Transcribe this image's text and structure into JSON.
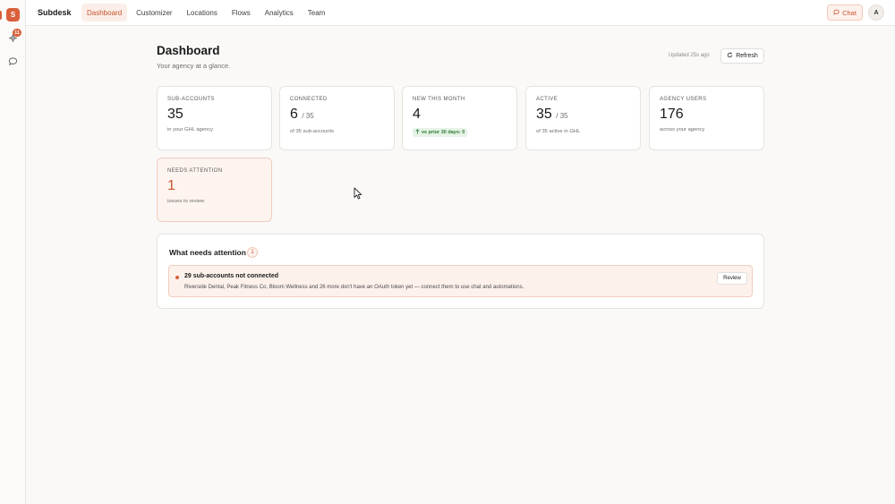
{
  "rail": {
    "logo_letter": "S",
    "notifications_badge": "11"
  },
  "topbar": {
    "brand": "Subdesk",
    "nav": [
      "Dashboard",
      "Customizer",
      "Locations",
      "Flows",
      "Analytics",
      "Team"
    ],
    "active_nav": "Dashboard",
    "chat_label": "Chat",
    "avatar_initial": "A"
  },
  "header": {
    "title": "Dashboard",
    "subtitle": "Your agency at a glance.",
    "updated": "Updated 25s ago",
    "refresh_label": "Refresh"
  },
  "stats": [
    {
      "label": "SUB-ACCOUNTS",
      "value": "35",
      "of": "",
      "note": "in your GHL agency"
    },
    {
      "label": "CONNECTED",
      "value": "6",
      "of": "/ 35",
      "note": "of 35 sub-accounts"
    },
    {
      "label": "NEW THIS MONTH",
      "value": "4",
      "of": "",
      "trend": "vs prior 30 days: 0"
    },
    {
      "label": "ACTIVE",
      "value": "35",
      "of": "/ 35",
      "note": "of 35 active in GHL"
    },
    {
      "label": "AGENCY USERS",
      "value": "176",
      "of": "",
      "note": "across your agency"
    },
    {
      "label": "NEEDS ATTENTION",
      "value": "1",
      "of": "",
      "note": "issues to review"
    }
  ],
  "attention": {
    "title": "What needs attention",
    "count": "1",
    "issue": {
      "title": "29 sub-accounts not connected",
      "description": "Riverside Dental, Peak Fitness Co, Bloom Wellness and 26 more don't have an OAuth token yet — connect them to use chat and automations.",
      "action_label": "Review"
    }
  },
  "colors": {
    "accent": "#d9603b",
    "accent_text": "#c9552f",
    "accent_bg": "#fdf1ec",
    "success_bg": "#e6f3e6",
    "success_text": "#2f7a35",
    "background": "#faf9f7"
  },
  "icons": {
    "rail": [
      "sparkle-icon",
      "chat-bubble-icon"
    ],
    "chat_button": "chat-bubble-icon",
    "refresh_button": "refresh-icon",
    "trend": "arrow-up-icon",
    "cursor": "mouse-pointer-icon"
  }
}
